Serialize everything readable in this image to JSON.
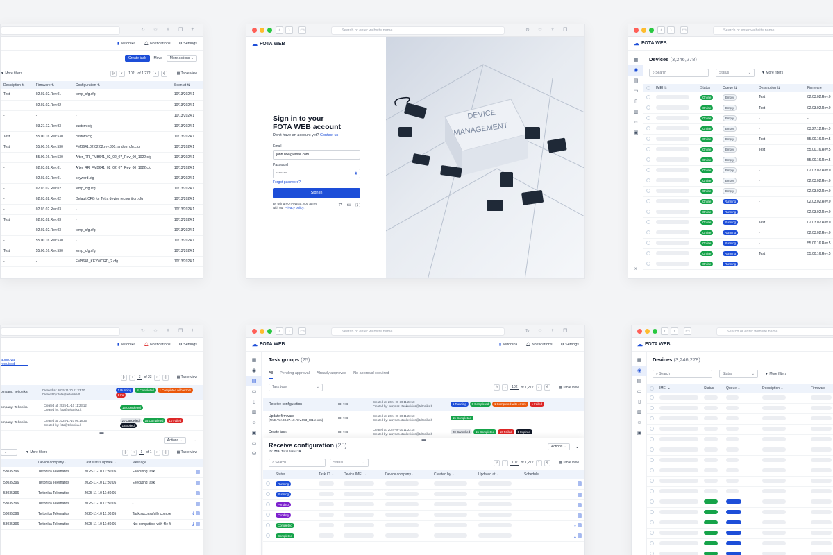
{
  "browser": {
    "url_placeholder": "Search or enter website name"
  },
  "app": {
    "name": "FOTA WEB",
    "company": "Teltonika",
    "notifications": "Notifications",
    "settings": "Settings",
    "table_view": "Table view",
    "more_filters": "More filters",
    "search": "Search",
    "status": "Status",
    "actions": "Actions"
  },
  "win1": {
    "create_task": "Create task",
    "move": "Move",
    "more_actions": "More actions",
    "page": "102",
    "page_of": "of 1,272",
    "cols": [
      "Description",
      "Firmware",
      "Configuration",
      "Seen at"
    ],
    "rows": [
      [
        "Test",
        "02.03.02.Rev.01",
        "temp_cfg.cfg",
        "10/13/2024 1"
      ],
      [
        "-",
        "02.03.02.Rev.02",
        "-",
        "10/13/2024 1"
      ],
      [
        "-",
        "-",
        "-",
        "10/13/2024 1"
      ],
      [
        "-",
        "03.27.12.Rev.93",
        "custom.cfg",
        "10/13/2024 1"
      ],
      [
        "Test",
        "55.00.16.Rev.530",
        "custom.cfg",
        "10/13/2024 1"
      ],
      [
        "Test",
        "55.00.16.Rev.530",
        "FMB641.02.02.02.rev.300.random cfg.cfg",
        "10/13/2024 1"
      ],
      [
        "-",
        "55.00.16.Rev.530",
        "After_RR_FMB641_02_02_07_Rev_00_1022.cfg",
        "10/13/2024 1"
      ],
      [
        "-",
        "02.03.02.Rev.01",
        "After_RR_FMB641_02_02_07_Rev_00_1022.cfg",
        "10/13/2024 1"
      ],
      [
        "-",
        "02.03.02.Rev.01",
        "keyword.cfg",
        "10/13/2024 1"
      ],
      [
        "-",
        "02.03.02.Rev.02",
        "temp_cfg.cfg",
        "10/13/2024 1"
      ],
      [
        "-",
        "02.03.02.Rev.02",
        "Default CFG for Tetra device recognition.cfg",
        "10/13/2024 1"
      ],
      [
        "-",
        "02.03.02.Rev.03",
        "-",
        "10/13/2024 1"
      ],
      [
        "Test",
        "02.03.02.Rev.03",
        "-",
        "10/13/2024 1"
      ],
      [
        "-",
        "02.03.02.Rev.03",
        "temp_cfg.cfg",
        "10/13/2024 1"
      ],
      [
        "-",
        "55.00.16.Rev.530",
        "-",
        "10/13/2024 1"
      ],
      [
        "Test",
        "55.00.16.Rev.530",
        "temp_cfg.cfg",
        "10/13/2024 1"
      ],
      [
        "-",
        "-",
        "FMB641_KEYWORD_2.cfg",
        "10/13/2024 1"
      ]
    ]
  },
  "login": {
    "title_line1": "Sign in to your",
    "title_line2": "FOTA WEB account",
    "no_account": "Don't have an account yet?",
    "contact": "Contact us",
    "email_label": "Email",
    "email_value": "john.doe@email.com",
    "password_label": "Password",
    "password_value": "•••••••••",
    "forgot": "Forgot password?",
    "sign_in": "Sign in",
    "terms_line1": "By using FOTA WEB, you agree",
    "terms_line2": "with our",
    "privacy": "Privacy policy.",
    "hero_text_1": "DEVICE",
    "hero_text_2": "MANAGEMENT"
  },
  "devices": {
    "title": "Devices",
    "count": "(3,246,278)",
    "cols": [
      "IMEI",
      "Status",
      "Queue",
      "Description",
      "Firmware"
    ],
    "rows": [
      [
        "Online",
        "Empty",
        "Test",
        "02.03.02.Rev.0"
      ],
      [
        "Online",
        "Empty",
        "Test",
        "02.03.02.Rev.0"
      ],
      [
        "Online",
        "Empty",
        "-",
        "-"
      ],
      [
        "Online",
        "Empty",
        "-",
        "03.27.12.Rev.9"
      ],
      [
        "Online",
        "Empty",
        "Test",
        "55.00.16.Rev.5"
      ],
      [
        "Online",
        "Empty",
        "Test",
        "55.00.16.Rev.5"
      ],
      [
        "Online",
        "Empty",
        "-",
        "55.00.16.Rev.5"
      ],
      [
        "Online",
        "Empty",
        "-",
        "02.03.02.Rev.0"
      ],
      [
        "Online",
        "Empty",
        "-",
        "02.03.02.Rev.0"
      ],
      [
        "Online",
        "Empty",
        "-",
        "02.03.02.Rev.0"
      ],
      [
        "Online",
        "Running",
        "-",
        "02.03.02.Rev.0"
      ],
      [
        "Online",
        "Running",
        "-",
        "02.03.02.Rev.0"
      ],
      [
        "Online",
        "Running",
        "Test",
        "02.03.02.Rev.0"
      ],
      [
        "Online",
        "Running",
        "-",
        "02.03.02.Rev.0"
      ],
      [
        "Online",
        "Running",
        "-",
        "55.00.16.Rev.5"
      ],
      [
        "Online",
        "Running",
        "Test",
        "55.00.16.Rev.5"
      ],
      [
        "Online",
        "Running",
        "-",
        "-"
      ]
    ]
  },
  "win4": {
    "approval": "approval required",
    "page": "3",
    "page_of": "of 23",
    "page2": "1",
    "page2_of": "of 1",
    "tasks": [
      {
        "company": "ompany: Teltonika",
        "created_at": "Created at: 2025-11-10 11:23:10",
        "created_by": "Created by: fota@teltonika.lt",
        "badges": [
          [
            "1 Running",
            "running"
          ],
          [
            "8 Completed",
            "completed"
          ],
          [
            "1 Completed with errors",
            "errs"
          ],
          [
            "1 Fa",
            "failed"
          ]
        ]
      },
      {
        "company": "ompany: Teltonika",
        "created_at": "Created at: 2025-11-10 11:23:12",
        "created_by": "Created by: fota@teltonika.lt",
        "badges": [
          [
            "15 Completed",
            "completed"
          ]
        ]
      },
      {
        "company": "ompany: Teltonika",
        "created_at": "Created at: 2025-11-10 09:18:35",
        "created_by": "Created by: fota@teltonika.lt",
        "badges": [
          [
            "20 Cancelled",
            "cancel"
          ],
          [
            "15 Completed",
            "completed"
          ],
          [
            "10 Failed",
            "failed"
          ],
          [
            "1 Expired",
            "expired"
          ]
        ]
      }
    ],
    "cols": [
      "Device company",
      "Last status update",
      "Message"
    ],
    "rows": [
      [
        "58035396",
        "Teltonika Telematics",
        "2025-11-10 11:30:05",
        "Executing task"
      ],
      [
        "58035396",
        "Teltonika Telematics",
        "2025-11-10 11:30:05",
        "Executing task"
      ],
      [
        "58035396",
        "Teltonika Telematics",
        "2025-11-10 11:30:05",
        "-"
      ],
      [
        "58035396",
        "Teltonika Telematics",
        "2025-11-10 11:30:05",
        "-"
      ],
      [
        "58035396",
        "Teltonika Telematics",
        "2025-11-10 11:30:05",
        "Task successfully comple"
      ],
      [
        "58035396",
        "Teltonika Telematics",
        "2025-11-10 11:30:05",
        "Not compatible with file fi"
      ]
    ]
  },
  "win5": {
    "title": "Task groups",
    "count": "(25)",
    "tabs": [
      "All",
      "Pending approval",
      "Already approved",
      "No approval required"
    ],
    "task_type": "Task type",
    "page": "102",
    "page_of": "of 1,272",
    "groups": [
      {
        "name": "Receive configuration",
        "name2": "",
        "id": "ID: 746",
        "created_at": "Created at: 2024-06-30 11:23:18",
        "created_by": "Created by: laurynas.stankevicius@teltonika.lt",
        "badges": [
          [
            "1 Running",
            "running"
          ],
          [
            "8 Completed",
            "completed"
          ],
          [
            "1 Completed with errors",
            "errs"
          ],
          [
            "1 Failed",
            "failed"
          ]
        ]
      },
      {
        "name": "Update firmware",
        "name2": "(FMB.Ver.03.27.10.Rev.953_ID1.e.xim)",
        "id": "ID: 746",
        "created_at": "Created at: 2024-06-30 11:23:18",
        "created_by": "Created by: laurynas.stankevicius@teltonika.lt",
        "badges": [
          [
            "15 Completed",
            "completed"
          ]
        ]
      },
      {
        "name": "Create task",
        "name2": "",
        "id": "ID: 746",
        "created_at": "Created at: 2024-06-30 11:23:18",
        "created_by": "Created by: laurynas.stankevicius@teltonika.lt",
        "badges": [
          [
            "20 Cancelled",
            "cancel"
          ],
          [
            "15 Completed",
            "completed"
          ],
          [
            "10 Failed",
            "failed"
          ],
          [
            "1 Expired",
            "expired"
          ]
        ]
      }
    ],
    "panel_title": "Receive configuration",
    "panel_count": "(25)",
    "panel_id": "ID:",
    "panel_id_val": "746",
    "panel_total": "Total tasks:",
    "panel_total_val": "9",
    "page2": "102",
    "page2_of": "of 1,272",
    "cols": [
      "Status",
      "Task ID",
      "Device IMEI",
      "Device company",
      "Created by",
      "Updated at",
      "Schedule"
    ],
    "rows": [
      [
        "Running",
        "running"
      ],
      [
        "Running",
        "running"
      ],
      [
        "Pending",
        "pending"
      ],
      [
        "Pending",
        "pending"
      ],
      [
        "Completed",
        "completed"
      ],
      [
        "Completed",
        "completed"
      ]
    ]
  },
  "win6": {
    "title": "Devices",
    "count": "(3,246,278)",
    "cols": [
      "IMEI",
      "Status",
      "Queue",
      "Description",
      "Firmware"
    ]
  }
}
